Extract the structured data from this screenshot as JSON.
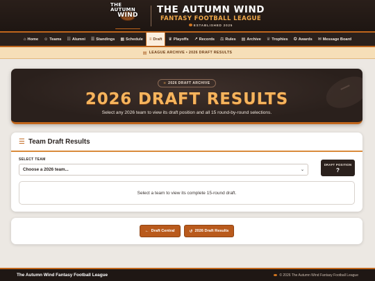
{
  "logo": {
    "line1": "THE AUTUMN",
    "line2": "WIND"
  },
  "header": {
    "title": "THE AUTUMN WIND",
    "subtitle": "FANTASY FOOTBALL LEAGUE",
    "established": "ESTABLISHED 2025"
  },
  "nav": {
    "items": [
      {
        "label": "Home",
        "icon": "home-icon",
        "glyph": "⌂"
      },
      {
        "label": "Teams",
        "icon": "users-icon",
        "glyph": "👥"
      },
      {
        "label": "Alumni",
        "icon": "alumni-icon",
        "glyph": "☷"
      },
      {
        "label": "Standings",
        "icon": "standings-icon",
        "glyph": "☰"
      },
      {
        "label": "Schedule",
        "icon": "calendar-icon",
        "glyph": "▦"
      },
      {
        "label": "Draft",
        "icon": "list-icon",
        "glyph": "≡"
      },
      {
        "label": "Playoffs",
        "icon": "trophy-icon",
        "glyph": "♛"
      },
      {
        "label": "Records",
        "icon": "chart-icon",
        "glyph": "↗"
      },
      {
        "label": "Rules",
        "icon": "gavel-icon",
        "glyph": "⚖"
      },
      {
        "label": "Archive",
        "icon": "archive-icon",
        "glyph": "▤"
      },
      {
        "label": "Trophies",
        "icon": "trophy-icon",
        "glyph": "♕"
      },
      {
        "label": "Awards",
        "icon": "award-icon",
        "glyph": "✪"
      },
      {
        "label": "Message Board",
        "icon": "chat-icon",
        "glyph": "✉"
      }
    ],
    "active": "Draft"
  },
  "breadcrumb": {
    "text": "LEAGUE ARCHIVE • 2026 DRAFT RESULTS"
  },
  "hero": {
    "badge": "2026 DRAFT ARCHIVE",
    "title": "2026 DRAFT RESULTS",
    "subtitle": "Select any 2026 team to view its draft position and all 15 round-by-round selections."
  },
  "card": {
    "title": "Team Draft Results",
    "select_label": "SELECT TEAM",
    "select_value": "Choose a 2026 team...",
    "draft_position_label": "DRAFT POSITION",
    "draft_position_value": "?",
    "empty_message": "Select a team to view its complete 15-round draft."
  },
  "buttons": {
    "draft_central": "Draft Central",
    "draft_results": "2026 Draft Results"
  },
  "footer": {
    "left": "The Autumn Wind Fantasy Football League",
    "right": "© 2026 The Autumn Wind Fantasy Football League"
  },
  "colors": {
    "accent": "#c0661c",
    "dark": "#2a201c",
    "gold": "#f5b45d"
  }
}
